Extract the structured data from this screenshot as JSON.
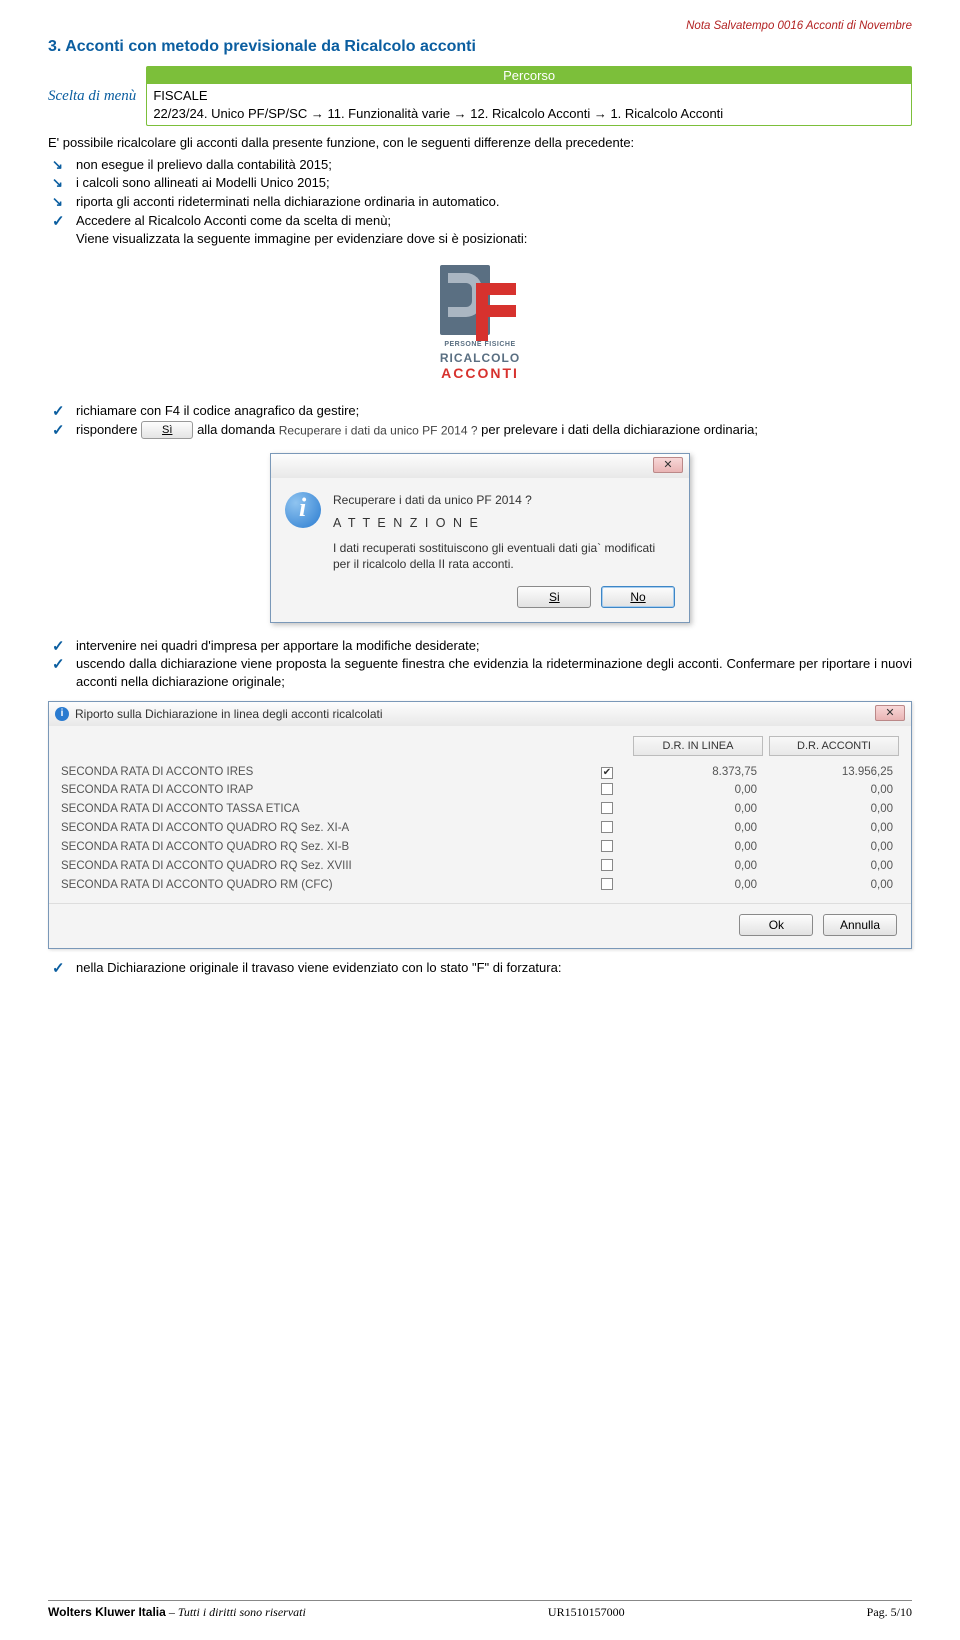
{
  "header_note": "Nota Salvatempo  0016 Acconti di Novembre",
  "section_title": "3. Acconti con metodo previsionale da Ricalcolo acconti",
  "menu_label": "Scelta di menù",
  "percorso": {
    "header": "Percorso",
    "line1": "FISCALE",
    "line2": "22/23/24. Unico PF/SP/SC → 11. Funzionalità varie → 12. Ricalcolo Acconti → 1. Ricalcolo Acconti"
  },
  "intro": "E' possibile ricalcolare gli acconti dalla presente funzione, con le seguenti differenze della precedente:",
  "arrow_items": [
    "non esegue il prelievo dalla contabilità 2015;",
    "i calcoli sono allineati ai Modelli Unico 2015;",
    "riporta gli acconti rideterminati nella dichiarazione ordinaria in automatico."
  ],
  "check_block1": {
    "line1": "Accedere al Ricalcolo Acconti come da scelta di menù;",
    "line2": "Viene visualizzata la seguente immagine per evidenziare dove si è posizionati:"
  },
  "pf_logo": {
    "t1": "PERSONE FISICHE",
    "t2": "RICALCOLO",
    "t3": "ACCONTI"
  },
  "check_block2": {
    "item1": "richiamare con F4 il codice anagrafico da gestire;",
    "item2a": "rispondere ",
    "btn_si": "Sì",
    "item2b": " alla domanda ",
    "question": "Recuperare i dati da unico PF 2014 ?",
    "item2c": " per prelevare i dati della dichiarazione ordinaria;"
  },
  "dialog1": {
    "q": "Recuperare i dati da unico PF 2014 ?",
    "att": "A T T E N Z I O N E",
    "body": "I dati recuperati sostituiscono gli eventuali dati  gia` modificati per  il ricalcolo della II rata acconti.",
    "yes": "Si",
    "no": "No"
  },
  "check_block3": {
    "item1": "intervenire nei quadri d'impresa per apportare la modifiche desiderate;",
    "item2": "uscendo dalla dichiarazione viene proposta la seguente finestra che evidenzia la rideterminazione degli acconti. Confermare per riportare i nuovi acconti nella dichiarazione originale;"
  },
  "dialog2": {
    "title": "Riporto sulla Dichiarazione in linea degli acconti ricalcolati",
    "col1": "D.R. IN LINEA",
    "col2": "D.R. ACCONTI",
    "rows": [
      {
        "label": "SECONDA RATA DI ACCONTO IRES",
        "checked": true,
        "v1": "8.373,75",
        "v2": "13.956,25"
      },
      {
        "label": "SECONDA RATA DI ACCONTO IRAP",
        "checked": false,
        "v1": "0,00",
        "v2": "0,00"
      },
      {
        "label": "SECONDA RATA DI ACCONTO TASSA ETICA",
        "checked": false,
        "v1": "0,00",
        "v2": "0,00"
      },
      {
        "label": "SECONDA RATA DI ACCONTO QUADRO RQ Sez. XI-A",
        "checked": false,
        "v1": "0,00",
        "v2": "0,00"
      },
      {
        "label": "SECONDA RATA DI ACCONTO QUADRO RQ Sez. XI-B",
        "checked": false,
        "v1": "0,00",
        "v2": "0,00"
      },
      {
        "label": "SECONDA RATA DI ACCONTO QUADRO RQ Sez. XVIII",
        "checked": false,
        "v1": "0,00",
        "v2": "0,00"
      },
      {
        "label": "SECONDA RATA DI ACCONTO QUADRO RM (CFC)",
        "checked": false,
        "v1": "0,00",
        "v2": "0,00"
      }
    ],
    "ok": "Ok",
    "cancel": "Annulla"
  },
  "check_block4": {
    "item1": "nella Dichiarazione originale il travaso viene evidenziato con lo stato \"F\" di forzatura:"
  },
  "footer": {
    "company": "Wolters Kluwer Italia",
    "rights": " – Tutti i diritti sono riservati",
    "code": "UR1510157000",
    "page": "Pag. 5/10"
  }
}
